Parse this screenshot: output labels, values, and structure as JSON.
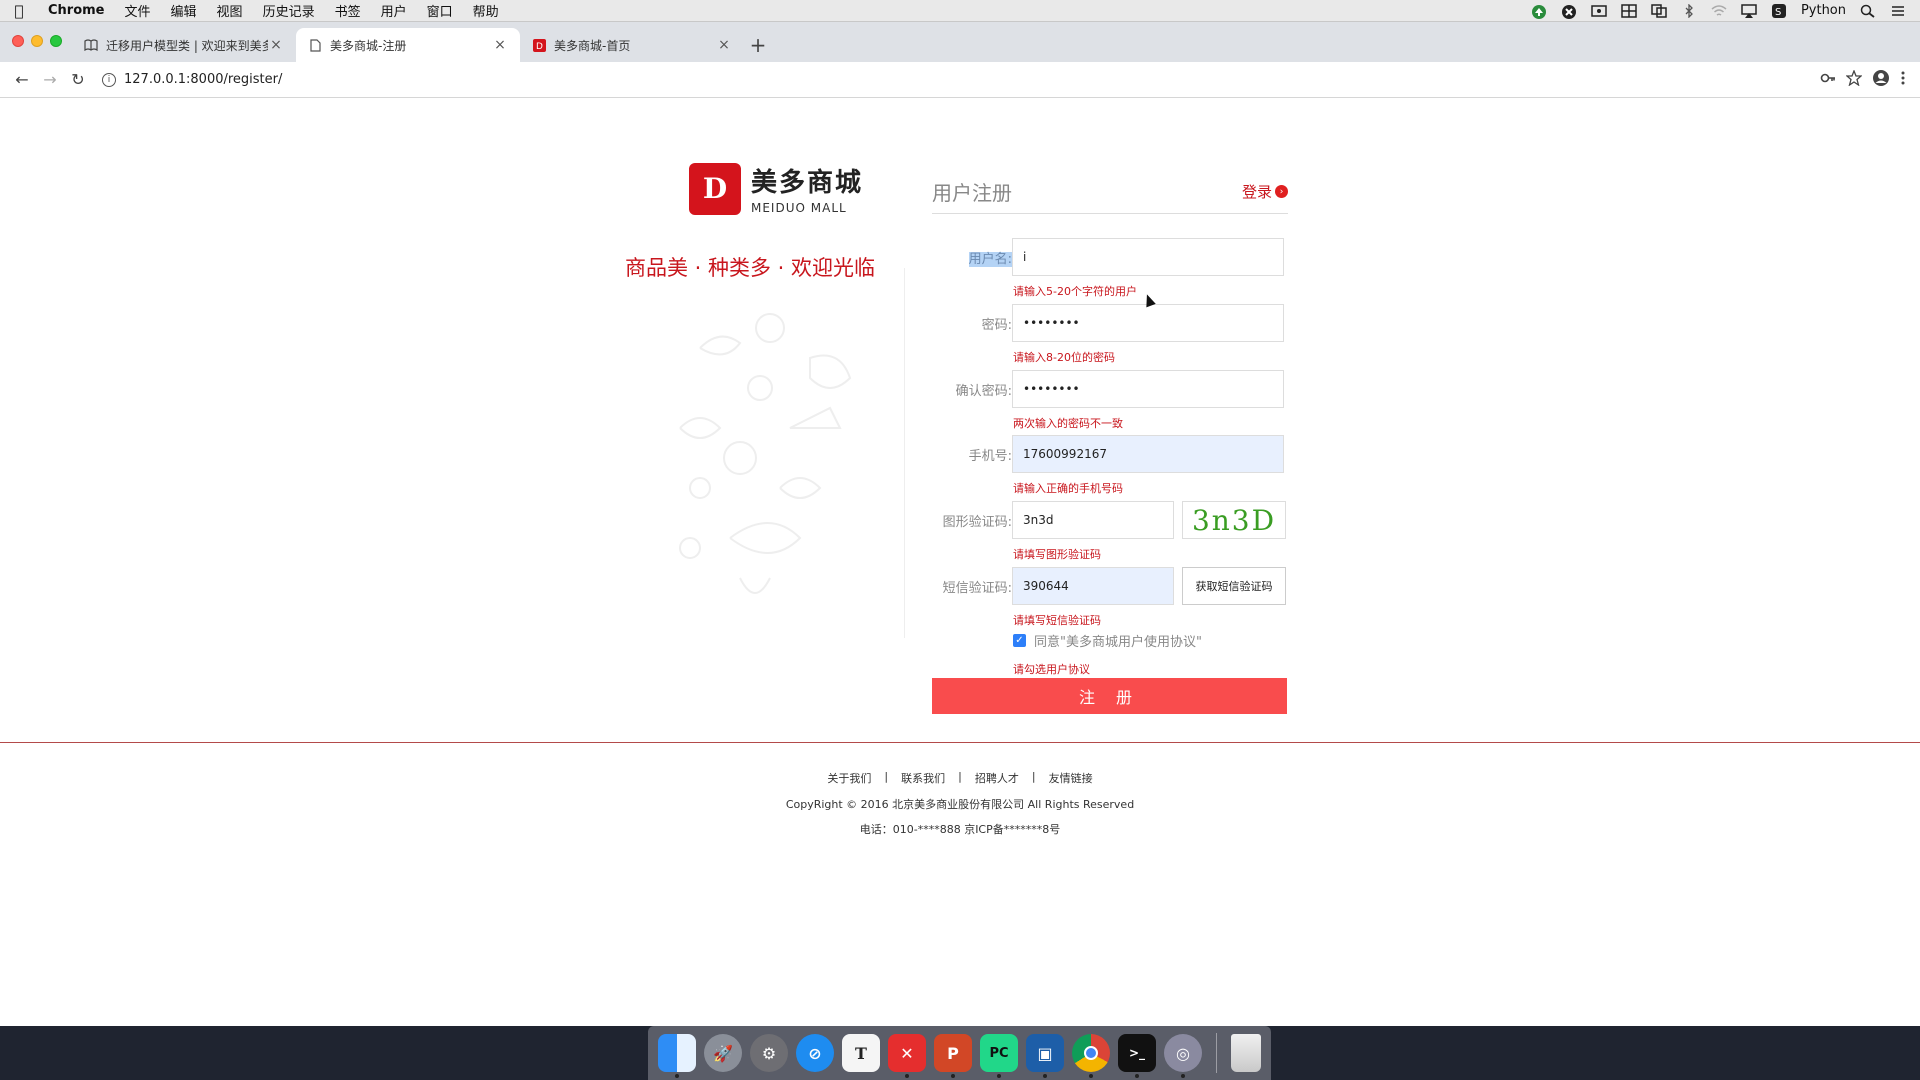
{
  "menubar": {
    "app_name": "Chrome",
    "items": [
      "文件",
      "编辑",
      "视图",
      "历史记录",
      "书签",
      "用户",
      "窗口",
      "帮助"
    ],
    "right_label": "Python"
  },
  "tabs": [
    {
      "title": "迁移用户模型类 | 欢迎来到美多",
      "active": false
    },
    {
      "title": "美多商城-注册",
      "active": true
    },
    {
      "title": "美多商城-首页",
      "active": false
    }
  ],
  "address": {
    "url": "127.0.0.1:8000/register/"
  },
  "brand": {
    "logo_mark": "D",
    "name_cn": "美多商城",
    "name_en": "MEIDUO MALL",
    "slogan": "商品美 · 种类多 · 欢迎光临"
  },
  "register": {
    "title": "用户注册",
    "login_link": "登录",
    "fields": {
      "username": {
        "label": "用户名:",
        "value": "i",
        "error": "请输入5-20个字符的用户"
      },
      "password": {
        "label": "密码:",
        "value": "••••••••",
        "error": "请输入8-20位的密码"
      },
      "password2": {
        "label": "确认密码:",
        "value": "••••••••",
        "error": "两次输入的密码不一致"
      },
      "mobile": {
        "label": "手机号:",
        "value": "17600992167",
        "error": "请输入正确的手机号码"
      },
      "image_code": {
        "label": "图形验证码:",
        "value": "3n3d",
        "error": "请填写图形验证码",
        "captcha_text": "3n3D"
      },
      "sms_code": {
        "label": "短信验证码:",
        "value": "390644",
        "error": "请填写短信验证码",
        "button": "获取短信验证码"
      }
    },
    "agreement": {
      "text": "同意\"美多商城用户使用协议\"",
      "error": "请勾选用户协议"
    },
    "submit": "注 册"
  },
  "footer": {
    "links": [
      "关于我们",
      "联系我们",
      "招聘人才",
      "友情链接"
    ],
    "separator": "|",
    "copyright": "CopyRight © 2016 北京美多商业股份有限公司 All Rights Reserved",
    "phone": "电话：010-****888  京ICP备*******8号"
  },
  "dock": {
    "apps": [
      "finder",
      "launchpad",
      "system-preferences",
      "safari",
      "typora",
      "xmind",
      "powerpoint",
      "pycharm",
      "virtualbox",
      "chrome",
      "terminal",
      "photo-app",
      "trash"
    ]
  }
}
